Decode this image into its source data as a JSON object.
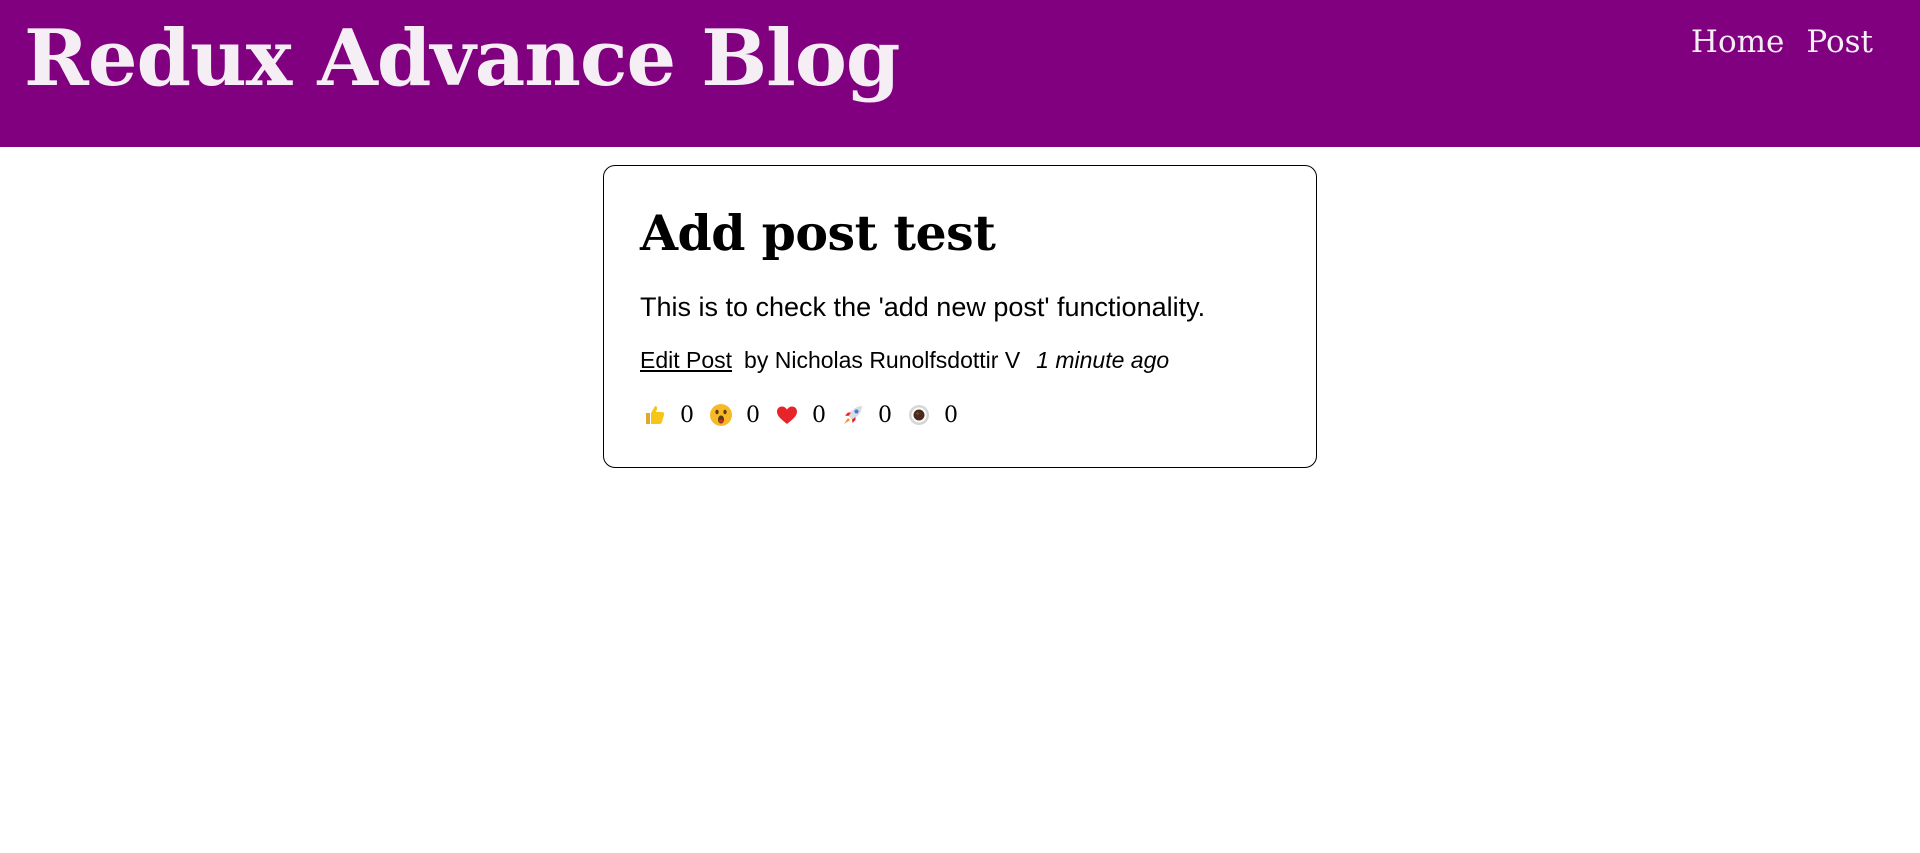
{
  "header": {
    "title": "Redux Advance Blog",
    "nav": [
      {
        "label": "Home"
      },
      {
        "label": "Post"
      }
    ]
  },
  "post": {
    "title": "Add post test",
    "body": "This is to check the 'add new post' functionality.",
    "edit_link": "Edit Post",
    "author": "by Nicholas Runolfsdottir V",
    "time_ago": "1 minute ago",
    "reactions": [
      {
        "icon": "thumbs-up-icon",
        "count": "0"
      },
      {
        "icon": "wow-face-icon",
        "count": "0"
      },
      {
        "icon": "heart-icon",
        "count": "0"
      },
      {
        "icon": "rocket-icon",
        "count": "0"
      },
      {
        "icon": "coffee-icon",
        "count": "0"
      }
    ]
  },
  "colors": {
    "header_bg": "#800080",
    "header_text": "#f5eef5",
    "heart": "#e8242b",
    "thumb": "#f5c518"
  }
}
